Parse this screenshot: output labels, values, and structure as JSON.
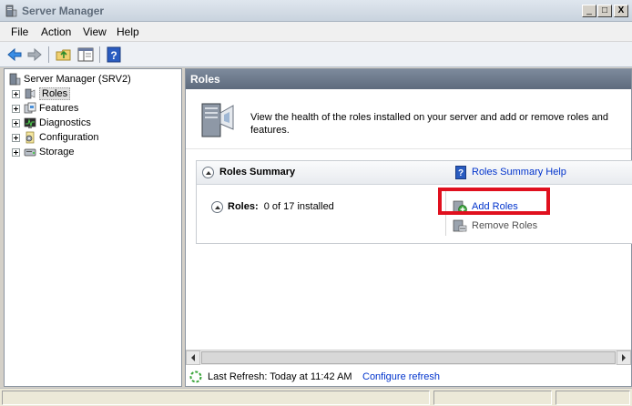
{
  "window": {
    "title": "Server Manager",
    "minimize_glyph": "_",
    "maximize_glyph": "□",
    "close_glyph": "X"
  },
  "menu": [
    "File",
    "Action",
    "View",
    "Help"
  ],
  "toolbar": {
    "icons": [
      "back-arrow-icon",
      "forward-arrow-icon",
      "up-folder-icon",
      "show-hide-console-tree-icon",
      "help-icon"
    ]
  },
  "tree": {
    "root": "Server Manager (SRV2)",
    "items": [
      {
        "label": "Roles",
        "icon": "roles-icon",
        "selected": true
      },
      {
        "label": "Features",
        "icon": "features-icon"
      },
      {
        "label": "Diagnostics",
        "icon": "diagnostics-icon"
      },
      {
        "label": "Configuration",
        "icon": "configuration-icon"
      },
      {
        "label": "Storage",
        "icon": "storage-icon"
      }
    ]
  },
  "content": {
    "header": "Roles",
    "description": "View the health of the roles installed on your server and add or remove roles and features.",
    "summary": {
      "title": "Roles Summary",
      "help_link": "Roles Summary Help",
      "roles_label": "Roles:",
      "roles_count": "0 of 17 installed",
      "add_roles": "Add Roles",
      "remove_roles": "Remove Roles"
    },
    "refresh": {
      "text": "Last Refresh: Today at 11:42 AM",
      "configure_link": "Configure refresh"
    }
  },
  "colors": {
    "highlight": "#e0101e",
    "link": "#0033cc",
    "header_bg": "#6b788a"
  }
}
